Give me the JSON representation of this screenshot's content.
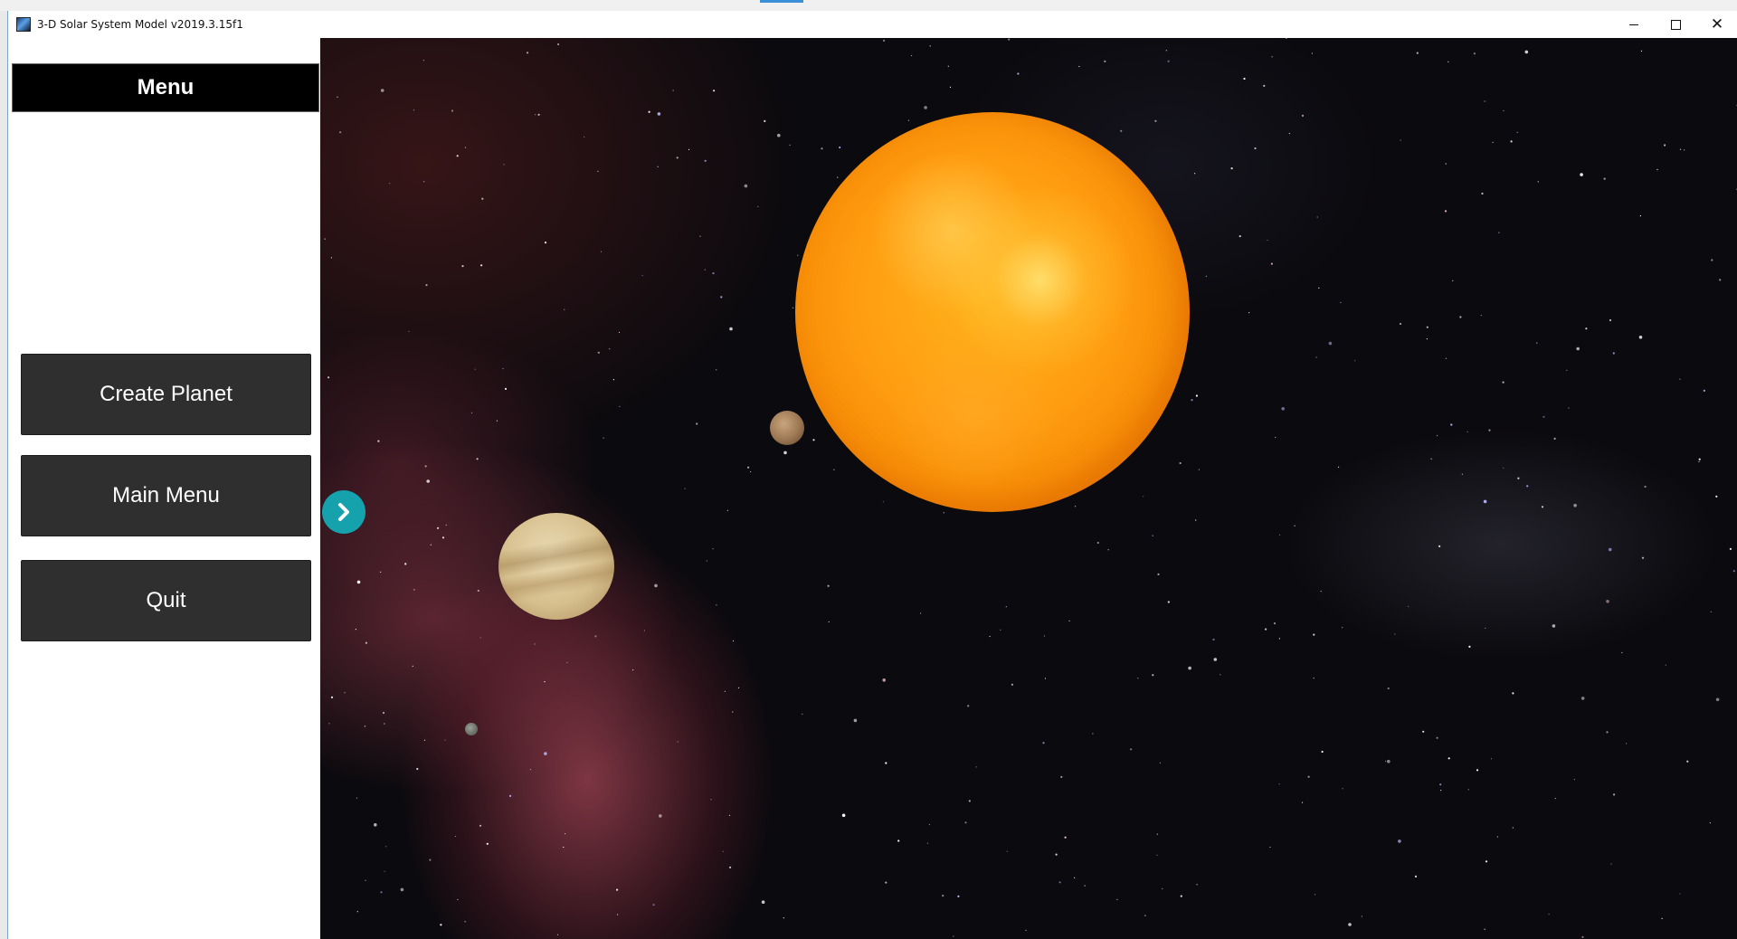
{
  "window": {
    "title": "3-D Solar System Model v2019.3.15f1",
    "icon": "app-icon",
    "controls": {
      "minimize": "minimize-icon",
      "maximize": "maximize-icon",
      "close": "✕"
    }
  },
  "menu": {
    "title": "Menu",
    "buttons": [
      {
        "label": "Create Planet"
      },
      {
        "label": "Main Menu"
      },
      {
        "label": "Quit"
      }
    ],
    "toggle_icon": "chevron-right-icon"
  },
  "scene": {
    "objects": [
      "sun",
      "mercury",
      "venus",
      "moonlet",
      "edge-planet"
    ],
    "colors": {
      "sun": "#ff9c10",
      "toggle": "#16a2ad",
      "button": "#2f2f2f",
      "header": "#000000"
    }
  }
}
